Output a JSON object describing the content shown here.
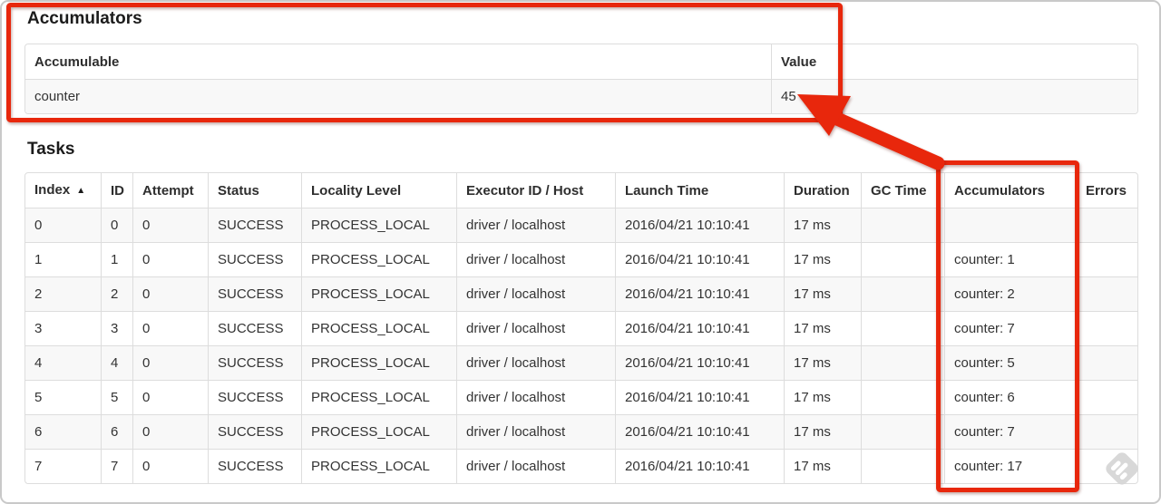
{
  "annotations": {
    "highlight_color": "#e8270c",
    "note": "red box around Accumulators section, red box around Accumulators task column, red arrow pointing at value 45"
  },
  "accumulators": {
    "title": "Accumulators",
    "headers": {
      "accumulable": "Accumulable",
      "value": "Value"
    },
    "rows": [
      {
        "accumulable": "counter",
        "value": "45"
      }
    ]
  },
  "tasks": {
    "title": "Tasks",
    "headers": {
      "index": "Index",
      "id": "ID",
      "attempt": "Attempt",
      "status": "Status",
      "locality": "Locality Level",
      "executor": "Executor ID / Host",
      "launch": "Launch Time",
      "duration": "Duration",
      "gc": "GC Time",
      "accumulators": "Accumulators",
      "errors": "Errors"
    },
    "sort_icon": "▲",
    "rows": [
      {
        "index": "0",
        "id": "0",
        "attempt": "0",
        "status": "SUCCESS",
        "locality": "PROCESS_LOCAL",
        "executor": "driver / localhost",
        "launch": "2016/04/21 10:10:41",
        "duration": "17 ms",
        "gc": "",
        "accumulators": "",
        "errors": ""
      },
      {
        "index": "1",
        "id": "1",
        "attempt": "0",
        "status": "SUCCESS",
        "locality": "PROCESS_LOCAL",
        "executor": "driver / localhost",
        "launch": "2016/04/21 10:10:41",
        "duration": "17 ms",
        "gc": "",
        "accumulators": "counter: 1",
        "errors": ""
      },
      {
        "index": "2",
        "id": "2",
        "attempt": "0",
        "status": "SUCCESS",
        "locality": "PROCESS_LOCAL",
        "executor": "driver / localhost",
        "launch": "2016/04/21 10:10:41",
        "duration": "17 ms",
        "gc": "",
        "accumulators": "counter: 2",
        "errors": ""
      },
      {
        "index": "3",
        "id": "3",
        "attempt": "0",
        "status": "SUCCESS",
        "locality": "PROCESS_LOCAL",
        "executor": "driver / localhost",
        "launch": "2016/04/21 10:10:41",
        "duration": "17 ms",
        "gc": "",
        "accumulators": "counter: 7",
        "errors": ""
      },
      {
        "index": "4",
        "id": "4",
        "attempt": "0",
        "status": "SUCCESS",
        "locality": "PROCESS_LOCAL",
        "executor": "driver / localhost",
        "launch": "2016/04/21 10:10:41",
        "duration": "17 ms",
        "gc": "",
        "accumulators": "counter: 5",
        "errors": ""
      },
      {
        "index": "5",
        "id": "5",
        "attempt": "0",
        "status": "SUCCESS",
        "locality": "PROCESS_LOCAL",
        "executor": "driver / localhost",
        "launch": "2016/04/21 10:10:41",
        "duration": "17 ms",
        "gc": "",
        "accumulators": "counter: 6",
        "errors": ""
      },
      {
        "index": "6",
        "id": "6",
        "attempt": "0",
        "status": "SUCCESS",
        "locality": "PROCESS_LOCAL",
        "executor": "driver / localhost",
        "launch": "2016/04/21 10:10:41",
        "duration": "17 ms",
        "gc": "",
        "accumulators": "counter: 7",
        "errors": ""
      },
      {
        "index": "7",
        "id": "7",
        "attempt": "0",
        "status": "SUCCESS",
        "locality": "PROCESS_LOCAL",
        "executor": "driver / localhost",
        "launch": "2016/04/21 10:10:41",
        "duration": "17 ms",
        "gc": "",
        "accumulators": "counter: 17",
        "errors": ""
      }
    ]
  },
  "icons": {
    "sort_ascending": "▲",
    "watermark": "skitch-diamond"
  }
}
